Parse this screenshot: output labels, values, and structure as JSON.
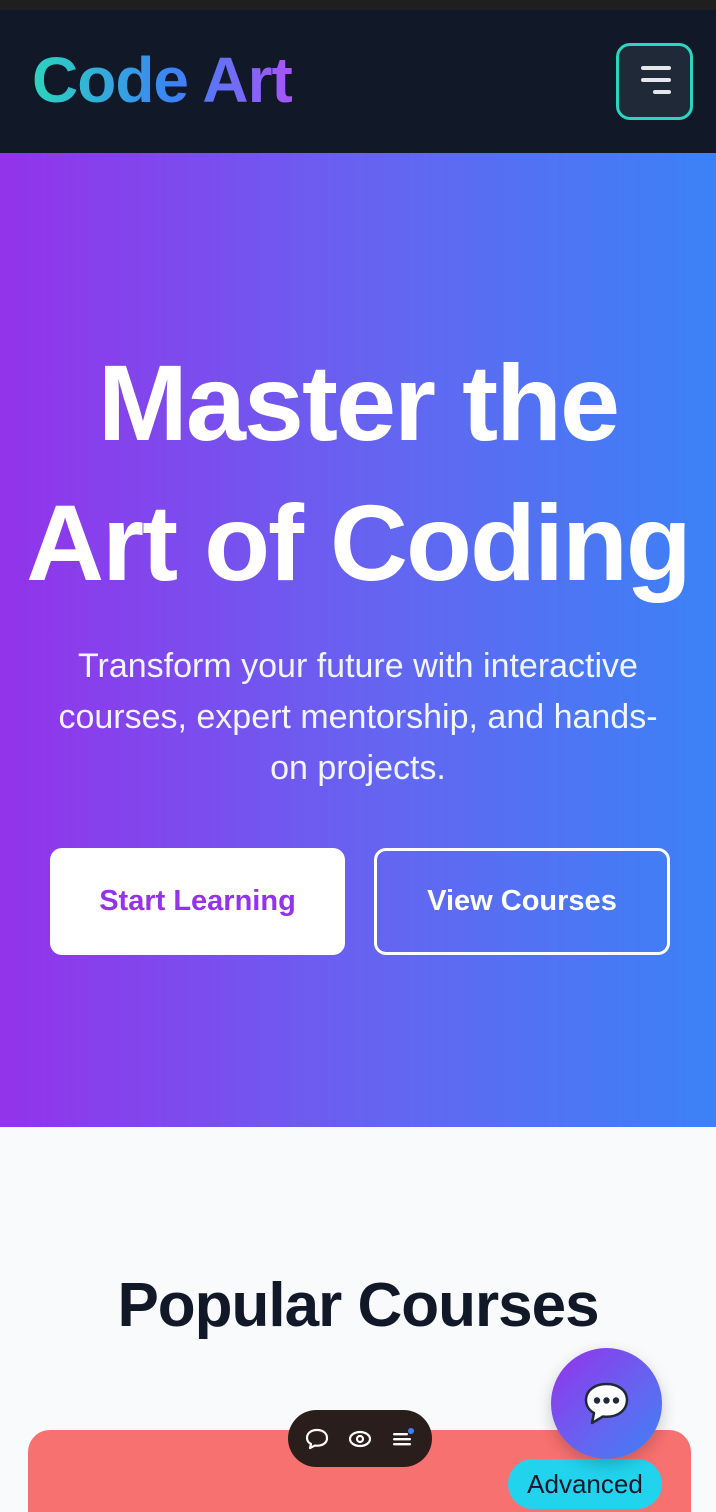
{
  "app": {
    "brand": "Code Art"
  },
  "nav": {
    "menu_icon": "hamburger-icon"
  },
  "hero": {
    "title_line1": "Master the",
    "title_line2": "Art of Coding",
    "subtitle_line1": "Transform your future with interactive",
    "subtitle_line2": "courses, expert mentorship, and hands-",
    "subtitle_line3": "on projects.",
    "primary_button": "Start Learning",
    "secondary_button": "View Courses"
  },
  "courses": {
    "section_title": "Popular Courses",
    "first_card": {
      "level": "Advanced"
    }
  },
  "toolbar": {
    "icons": [
      "chat-bubble-icon",
      "eye-icon",
      "menu-lines-icon"
    ]
  },
  "chat_fab": {
    "icon": "speech-bubble-icon"
  },
  "colors": {
    "nav_bg": "#111827",
    "hero_gradient_start": "#9333ea",
    "hero_gradient_end": "#3b82f6",
    "accent_teal": "#2dd4bf",
    "card_red": "#f87171",
    "badge_cyan": "#22d3ee"
  }
}
